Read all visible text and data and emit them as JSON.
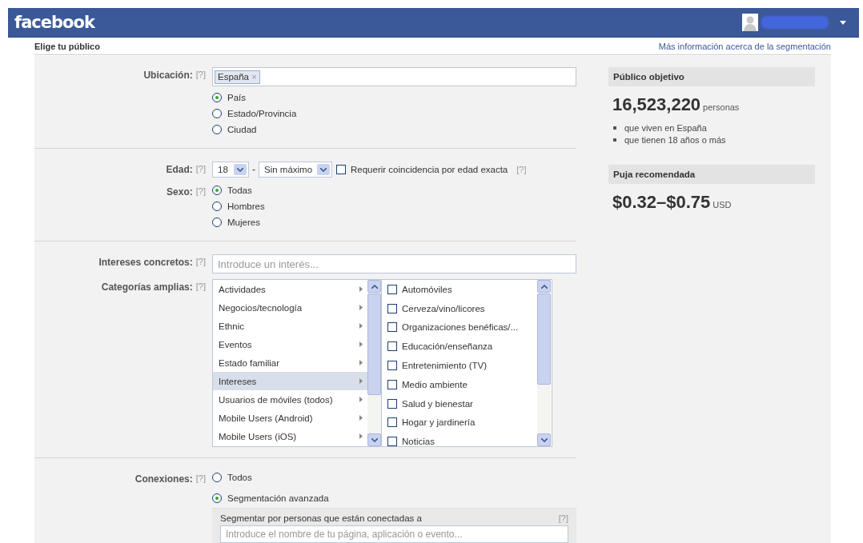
{
  "topbar": {
    "logo": "facebook"
  },
  "page": {
    "title": "Elige tu público",
    "link": "Más información acerca de la segmentación"
  },
  "location": {
    "label": "Ubicación:",
    "help": "[?]",
    "tokens": [
      {
        "text": "España",
        "remove": "×"
      }
    ],
    "options": [
      {
        "label": "País",
        "selected": true
      },
      {
        "label": "Estado/Provincia",
        "selected": false
      },
      {
        "label": "Ciudad",
        "selected": false
      }
    ]
  },
  "age": {
    "label": "Edad:",
    "help": "[?]",
    "min": "18",
    "separator": "-",
    "max": "Sin máximo",
    "exact": {
      "label": "Requerir coincidencia por edad exacta",
      "checked": false,
      "help": "[?]"
    }
  },
  "sex": {
    "label": "Sexo:",
    "help": "[?]",
    "options": [
      {
        "label": "Todas",
        "selected": true
      },
      {
        "label": "Hombres",
        "selected": false
      },
      {
        "label": "Mujeres",
        "selected": false
      }
    ]
  },
  "interests": {
    "label": "Intereses concretos:",
    "help": "[?]",
    "placeholder": "Introduce un interés..."
  },
  "categories": {
    "label": "Categorías amplias:",
    "help": "[?]",
    "items": [
      {
        "label": "Actividades",
        "selected": false
      },
      {
        "label": "Negocios/tecnología",
        "selected": false
      },
      {
        "label": "Ethnic",
        "selected": false
      },
      {
        "label": "Eventos",
        "selected": false
      },
      {
        "label": "Estado familiar",
        "selected": false
      },
      {
        "label": "Intereses",
        "selected": true
      },
      {
        "label": "Usuarios de móviles (todos)",
        "selected": false
      },
      {
        "label": "Mobile Users (Android)",
        "selected": false
      },
      {
        "label": "Mobile Users (iOS)",
        "selected": false
      }
    ],
    "subitems": [
      {
        "label": "Automóviles",
        "checked": false
      },
      {
        "label": "Cerveza/vino/licores",
        "checked": false
      },
      {
        "label": "Organizaciones benéficas/...",
        "checked": false
      },
      {
        "label": "Educación/enseñanza",
        "checked": false
      },
      {
        "label": "Entretenimiento (TV)",
        "checked": false
      },
      {
        "label": "Medio ambiente",
        "checked": false
      },
      {
        "label": "Salud y bienestar",
        "checked": false
      },
      {
        "label": "Hogar y jardinería",
        "checked": false
      },
      {
        "label": "Noticias",
        "checked": false
      }
    ]
  },
  "connections": {
    "label": "Conexiones:",
    "help": "[?]",
    "options": [
      {
        "label": "Todos",
        "selected": false
      },
      {
        "label": "Segmentación avanzada",
        "selected": true
      }
    ],
    "advanced": {
      "label": "Segmentar por personas que están conectadas a",
      "help": "[?]",
      "placeholder": "Introduce el nombre de tu página, aplicación o evento..."
    }
  },
  "audience": {
    "title": "Público objetivo",
    "count": "16,523,220",
    "unit": "personas",
    "criteria": [
      "que viven en España",
      "que tienen 18 años o más"
    ]
  },
  "bid": {
    "title": "Puja recomendada",
    "range": "$0.32–$0.75",
    "currency": "USD"
  }
}
